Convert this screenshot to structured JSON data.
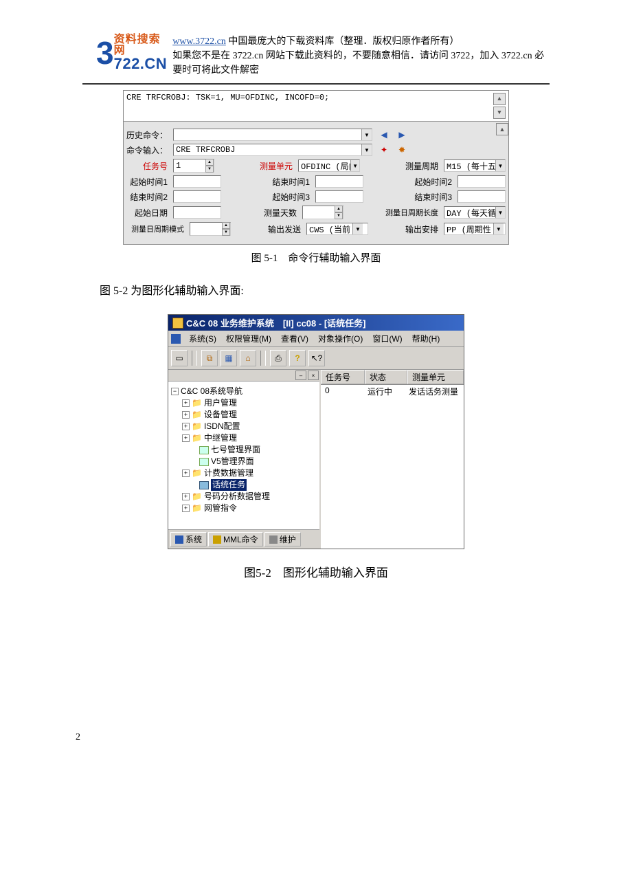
{
  "header": {
    "logo_big": "3",
    "logo_top": "资料搜索网",
    "logo_bottom": "722.CN",
    "link_text": "www.3722.cn",
    "line1_rest": " 中国最庞大的下载资料库（整理．版权归原作者所有）",
    "line2": "如果您不是在 3722.cn 网站下载此资料的，不要随意相信．请访问 3722，加入 3722.cn 必要时可将此文件解密"
  },
  "shot1": {
    "command_text": "CRE TRFCROBJ: TSK=1, MU=OFDINC, INCOFD=0;",
    "row_history_label": "历史命令：",
    "row_input_label": "命令输入：",
    "row_input_value": "CRE TRFCROBJ",
    "row2": {
      "task_label": "任务号",
      "task_value": "1",
      "mu_label": "测量单元",
      "mu_value": "OFDINC (局内",
      "period_label": "测量周期",
      "period_value": "M15 (每十五"
    },
    "row3": {
      "start1": "起始时间1",
      "end1": "结束时间1",
      "start2": "起始时间2"
    },
    "row4": {
      "end2": "结束时间2",
      "start3": "起始时间3",
      "end3": "结束时间3"
    },
    "row5": {
      "date": "起始日期",
      "days": "测量天数",
      "daylen_label": "测量日周期长度",
      "daylen_value": "DAY (每天循"
    },
    "row6": {
      "mode_label": "测量日周期模式",
      "out_send": "输出发送",
      "out_send_value": "CWS (当前",
      "out_arrange": "输出安排",
      "out_arrange_value": "PP (周期性"
    },
    "caption": "图 5-1　命令行辅助输入界面"
  },
  "midtext": "图 5-2 为图形化辅助输入界面:",
  "shot2": {
    "title": "C&C 08 业务维护系统　[II]  cc08 - [话统任务]",
    "menu": [
      "系统(S)",
      "权限管理(M)",
      "查看(V)",
      "对象操作(O)",
      "窗口(W)",
      "帮助(H)"
    ],
    "tree_root": "C&C 08系统导航",
    "tree_items": [
      "用户管理",
      "设备管理",
      "ISDN配置",
      "中继管理",
      "七号管理界面",
      "V5管理界面",
      "计费数据管理",
      "话统任务",
      "号码分析数据管理",
      "网管指令"
    ],
    "list_headers": [
      "任务号",
      "状态",
      "测量单元"
    ],
    "list_row": [
      "0",
      "运行中",
      "发话话务测量"
    ],
    "tabs": [
      "系统",
      "MML命令",
      "维护"
    ],
    "caption": "图5-2　图形化辅助输入界面"
  },
  "page_number": "2"
}
